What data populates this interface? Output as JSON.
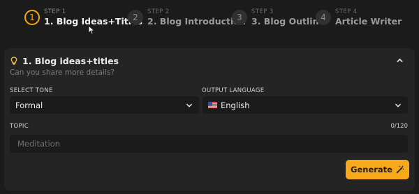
{
  "stepper": {
    "steps": [
      {
        "number": "1",
        "kicker": "STEP 1",
        "title": "1. Blog Ideas+Titles",
        "active": true
      },
      {
        "number": "2",
        "kicker": "STEP 2",
        "title": "2. Blog Introduction",
        "active": false
      },
      {
        "number": "3",
        "kicker": "STEP 3",
        "title": "3. Blog Outline",
        "active": false
      },
      {
        "number": "4",
        "kicker": "STEP 4",
        "title": "Article Writer",
        "active": false
      }
    ]
  },
  "card": {
    "icon": "bulb-icon",
    "title": "1. Blog ideas+titles",
    "subtitle": "Can you share more details?",
    "collapse_icon": "chevron-up-icon"
  },
  "form": {
    "tone": {
      "label": "SELECT TONE",
      "value": "Formal"
    },
    "language": {
      "label": "OUTPUT LANGUAGE",
      "value": "English",
      "flag": "us-flag"
    },
    "topic": {
      "label": "TOPIC",
      "counter": "0/120",
      "placeholder": "Meditation",
      "value": ""
    },
    "generate_label": "Generate",
    "generate_icon": "magic-wand-icon"
  },
  "colors": {
    "background": "#1b1b1b",
    "card": "#242424",
    "accent": "#f7a81b"
  }
}
